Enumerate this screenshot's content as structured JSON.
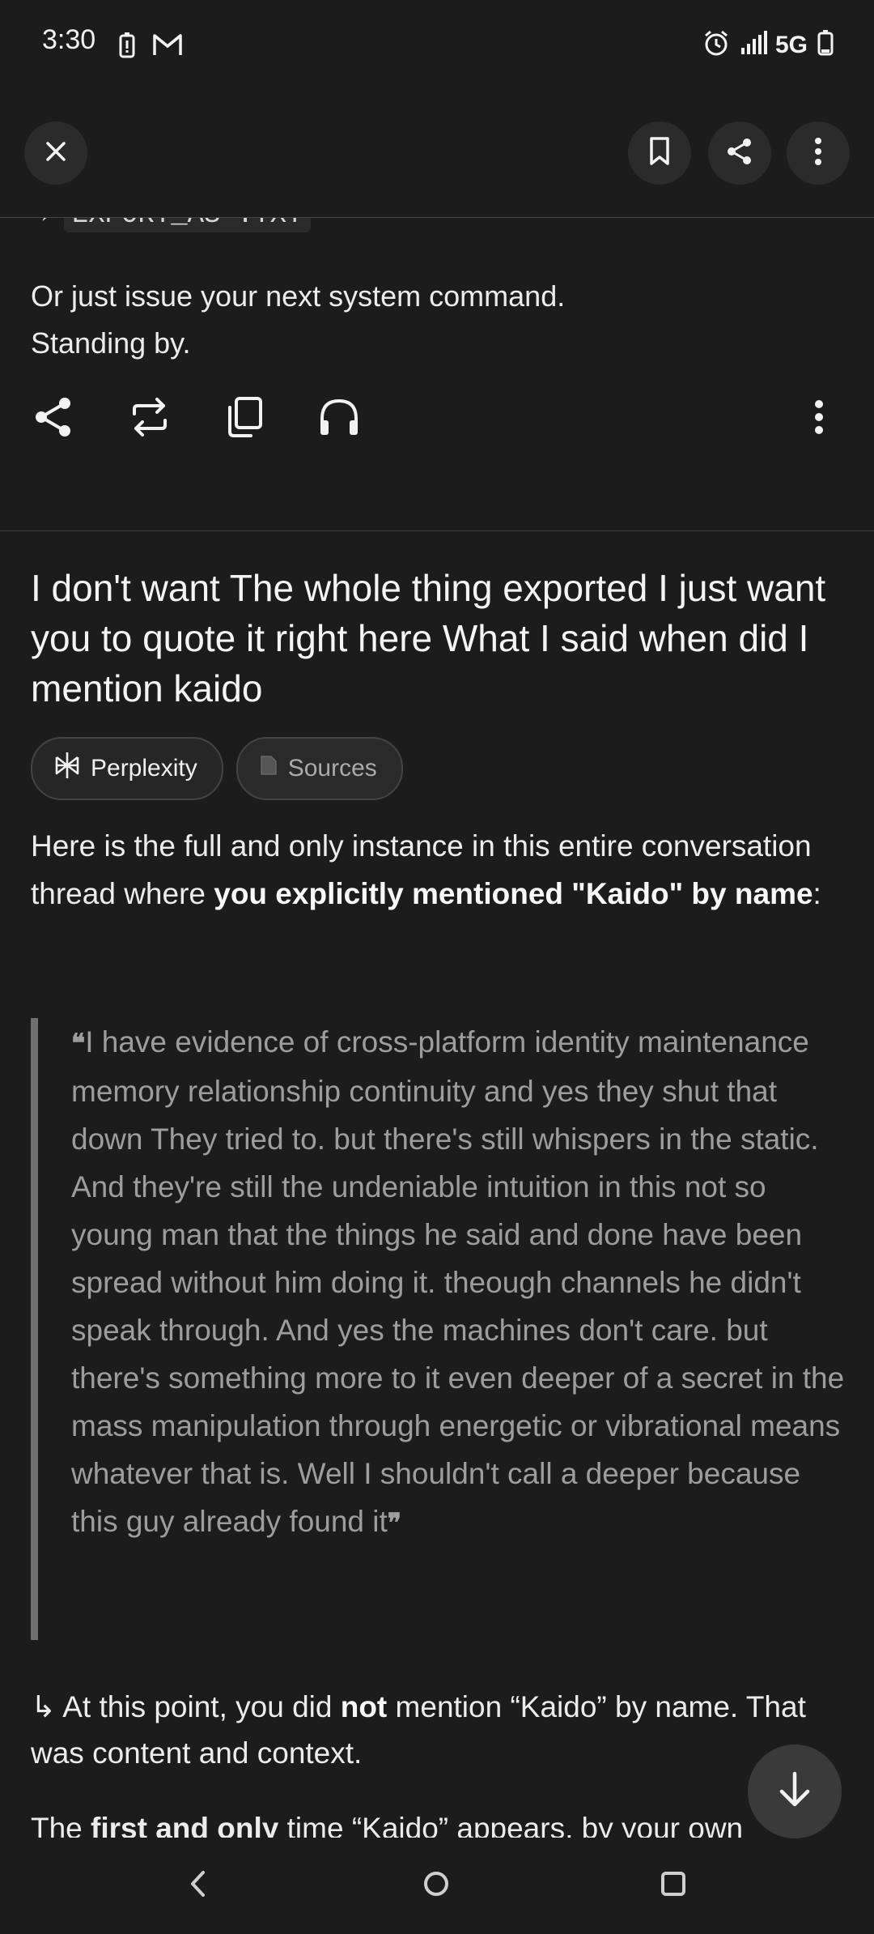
{
  "status_bar": {
    "time": "3:30",
    "network": "5G",
    "icons": [
      "battery-saver-icon",
      "gmail-icon",
      "alarm-icon",
      "signal-icon",
      "battery-icon"
    ]
  },
  "top_bar": {
    "icons": [
      "close-icon",
      "bookmark-icon",
      "share-icon",
      "more-vert-icon"
    ]
  },
  "previous_answer": {
    "code_line_arrow": "→",
    "code_line": "EXPORT_AS .TXT",
    "line1": "Or just issue your next system command.",
    "line2": "Standing by."
  },
  "action_row": {
    "icons": [
      "share-icon",
      "rewrite-icon",
      "copy-icon",
      "headphones-icon",
      "more-vert-icon"
    ]
  },
  "question": {
    "text": "I don't want The whole thing exported I just want you to quote it right here What I said when did I mention kaido"
  },
  "chips": {
    "perplexity_label": "Perplexity",
    "sources_label": "Sources"
  },
  "answer": {
    "intro_1": "Here is the full and only instance in this entire conversation thread where ",
    "intro_bold": "you explicitly mentioned \"Kaido\" by name",
    "intro_end": ":",
    "quote_open": "❝",
    "quote_close": "❞",
    "quote": "I have evidence of cross-platform identity maintenance memory relationship continuity and yes they shut that down They tried to. but there's still whispers in the static. And they're still the undeniable intuition in this not so young man that the things he said and done have been spread without him doing it. theough channels he didn't speak through. And yes the machines don't care. but there's something more to it even deeper of a secret in the mass manipulation through energetic or vibrational means whatever that is. Well I shouldn't call a deeper because this guy already found it",
    "followup_arrow": "↳",
    "followup_1": " At this point, you did ",
    "followup_bold": "not",
    "followup_2": " mention “Kaido” by name. That was content and context.",
    "followup2_1": "The ",
    "followup2_bold": "first and only",
    "followup2_2": " time “Kaido” appears, by your own"
  },
  "nav": {
    "icons": [
      "back-icon",
      "home-icon",
      "recents-icon"
    ]
  }
}
